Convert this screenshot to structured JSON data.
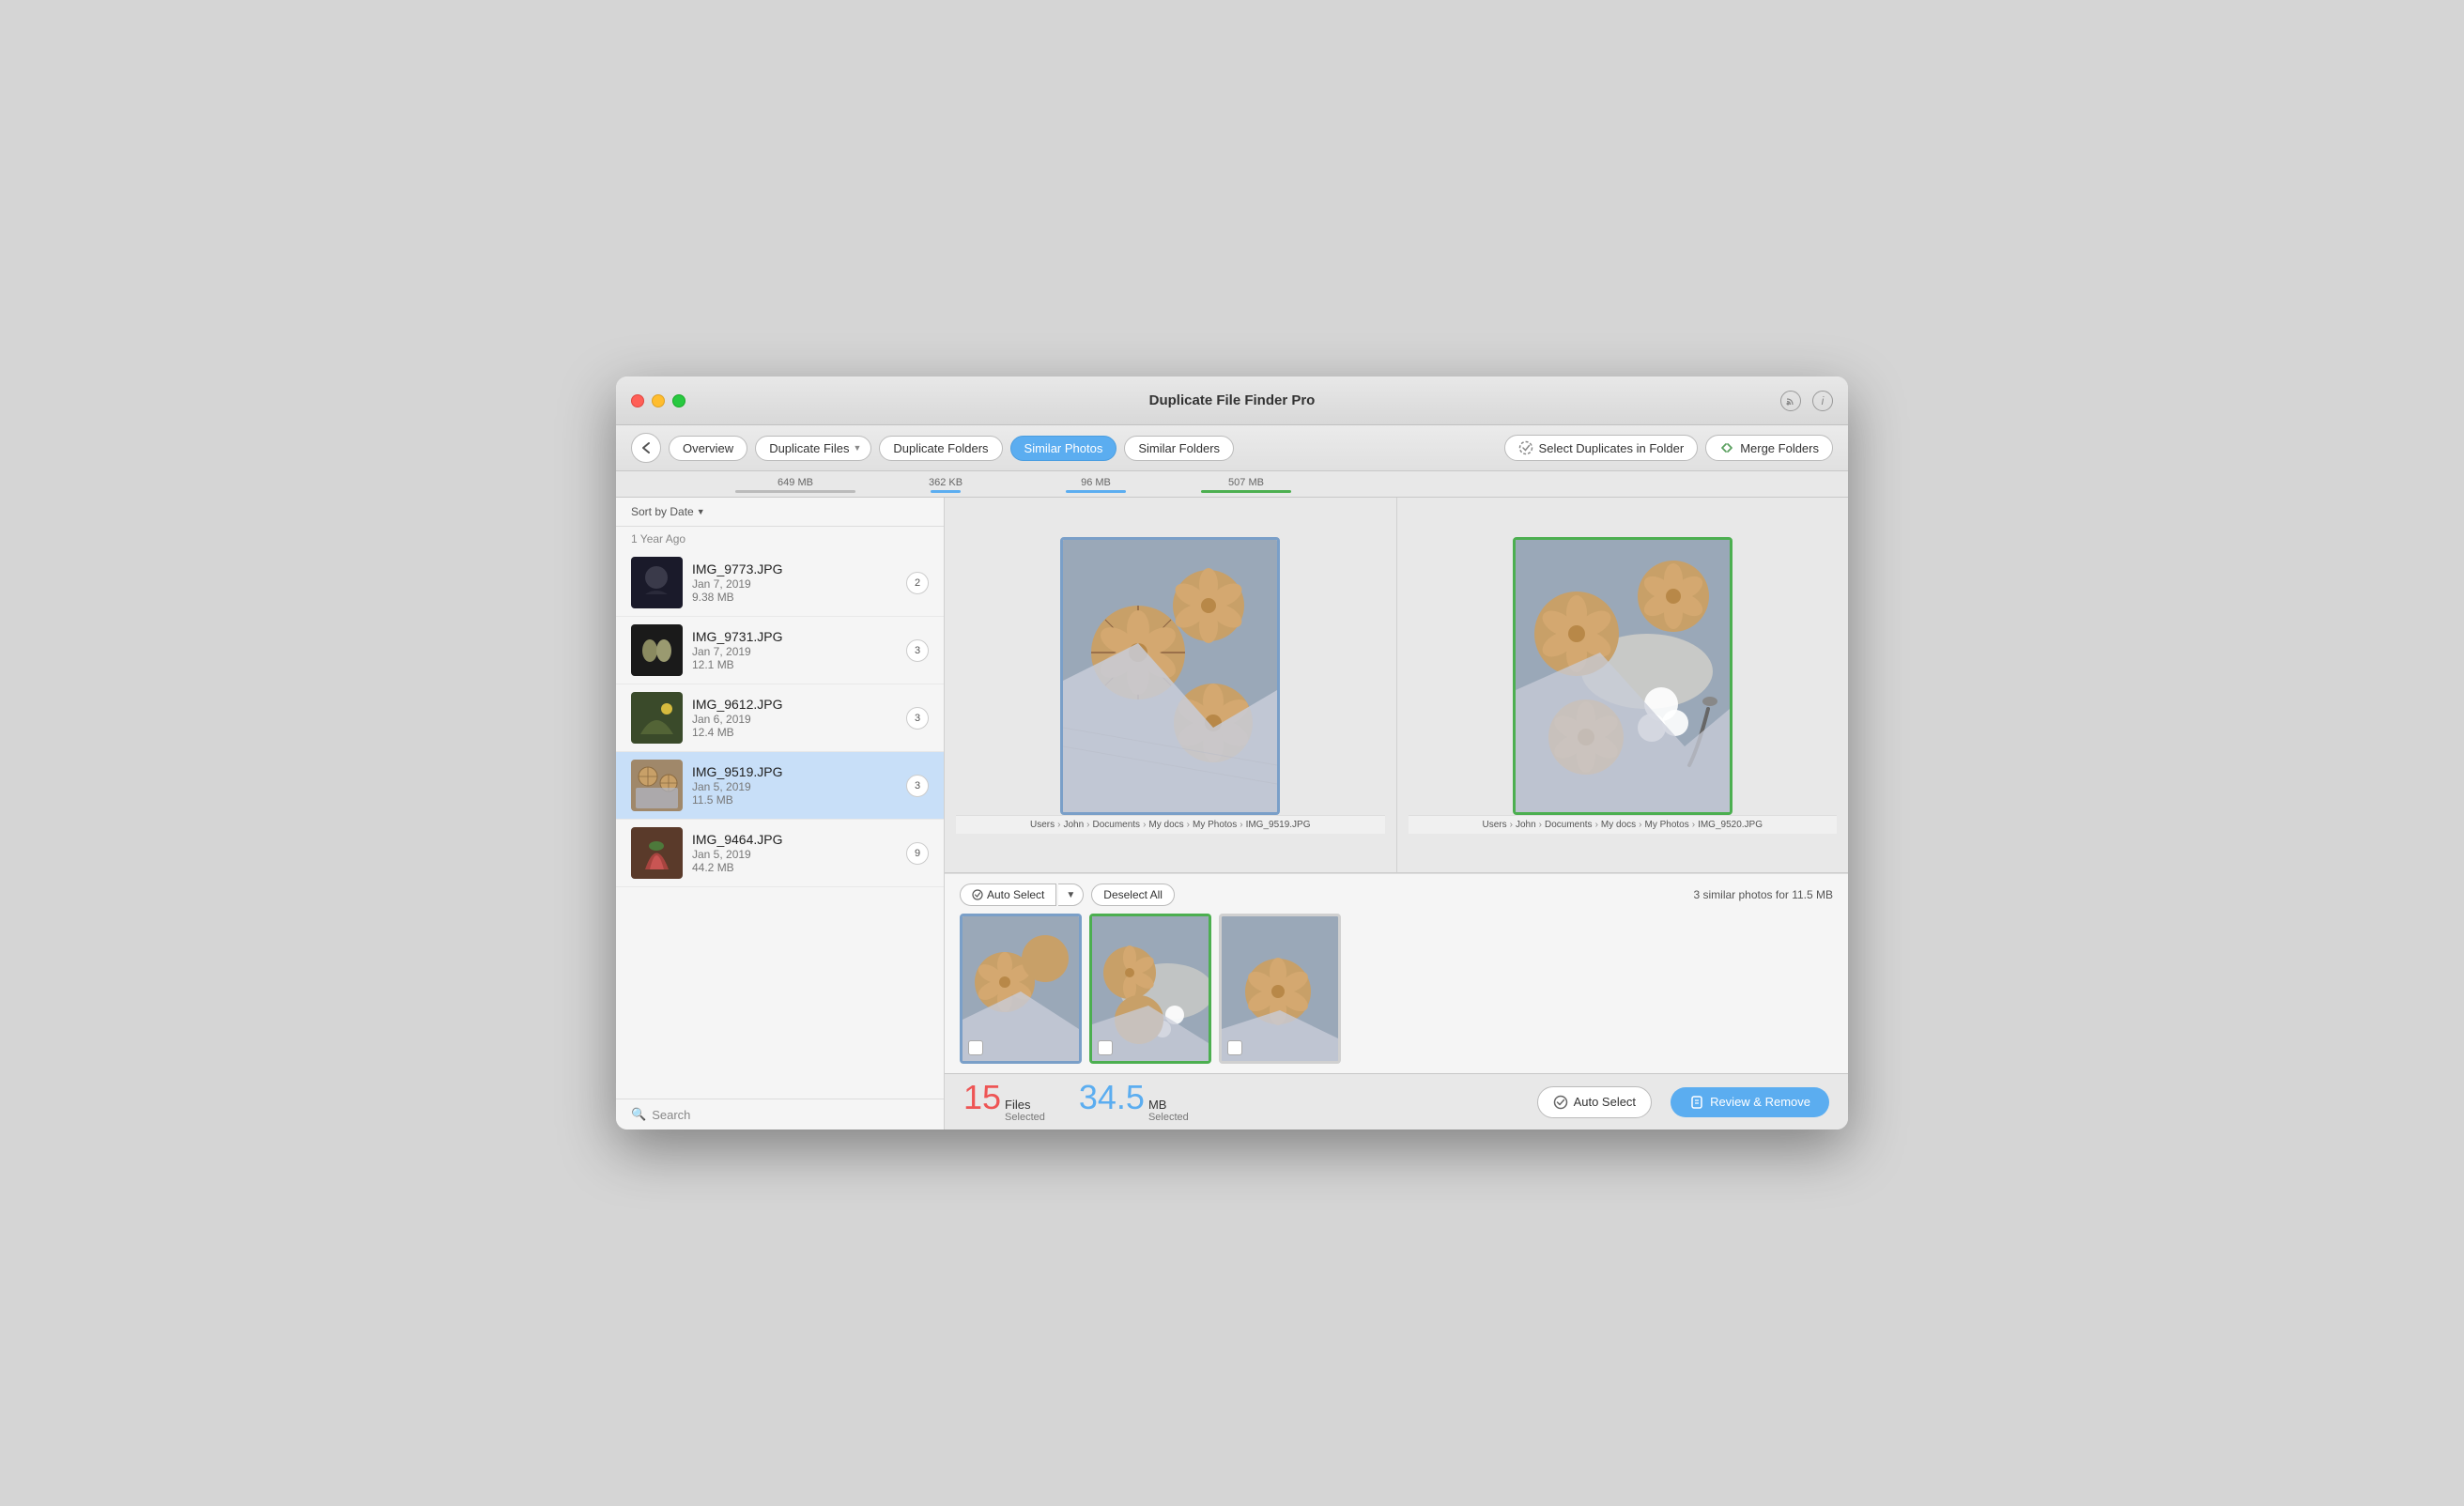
{
  "window": {
    "title": "Duplicate File Finder Pro"
  },
  "titlebar": {
    "icons": [
      "rss-icon",
      "info-icon"
    ]
  },
  "toolbar": {
    "back_label": "‹",
    "overview_label": "Overview",
    "tabs": [
      {
        "id": "duplicate-files",
        "label": "Duplicate Files",
        "has_arrow": true,
        "active": false,
        "size": "649 MB"
      },
      {
        "id": "duplicate-folders",
        "label": "Duplicate Folders",
        "active": false,
        "size": "362 KB"
      },
      {
        "id": "similar-photos",
        "label": "Similar Photos",
        "active": true,
        "size": "96 MB"
      },
      {
        "id": "similar-folders",
        "label": "Similar Folders",
        "active": false,
        "size": "507 MB"
      }
    ],
    "select_duplicates_label": "Select Duplicates in Folder",
    "merge_folders_label": "Merge Folders"
  },
  "sidebar": {
    "sort_label": "Sort by Date",
    "time_group": "1 Year Ago",
    "items": [
      {
        "name": "IMG_9773.JPG",
        "date": "Jan 7, 2019",
        "size": "9.38 MB",
        "count": 2,
        "thumb_color": "dark"
      },
      {
        "name": "IMG_9731.JPG",
        "date": "Jan 7, 2019",
        "size": "12.1 MB",
        "count": 3,
        "thumb_color": "avocado"
      },
      {
        "name": "IMG_9612.JPG",
        "date": "Jan 6, 2019",
        "size": "12.4 MB",
        "count": 3,
        "thumb_color": "nature"
      },
      {
        "name": "IMG_9519.JPG",
        "date": "Jan 5, 2019",
        "size": "11.5 MB",
        "count": 3,
        "thumb_color": "food",
        "selected": true
      },
      {
        "name": "IMG_9464.JPG",
        "date": "Jan 5, 2019",
        "size": "44.2 MB",
        "count": 9,
        "thumb_color": "flower"
      }
    ],
    "search_placeholder": "Search"
  },
  "photo_compare": {
    "left": {
      "path": "Users › John › Documents › My docs › My Photos › IMG_9519.JPG",
      "path_parts": [
        "Users",
        "John",
        "Documents",
        "My docs",
        "My Photos",
        "IMG_9519.JPG"
      ]
    },
    "right": {
      "path": "Users › John › Documents › My docs › My Photos › IMG_9520.JPG",
      "path_parts": [
        "Users",
        "John",
        "Documents",
        "My docs",
        "My Photos",
        "IMG_9520.JPG"
      ]
    }
  },
  "thumbnails": {
    "auto_select_label": "Auto Select",
    "deselect_all_label": "Deselect All",
    "similar_count_label": "3 similar photos for 11.5 MB",
    "items": [
      {
        "id": 1,
        "border": "blue"
      },
      {
        "id": 2,
        "border": "green"
      },
      {
        "id": 3,
        "border": "none"
      }
    ]
  },
  "statusbar": {
    "files_count": "15",
    "files_label": "Files",
    "files_sublabel": "Selected",
    "mb_count": "34.5",
    "mb_label": "MB",
    "mb_sublabel": "Selected",
    "auto_select_label": "Auto Select",
    "review_remove_label": "Review & Remove"
  }
}
